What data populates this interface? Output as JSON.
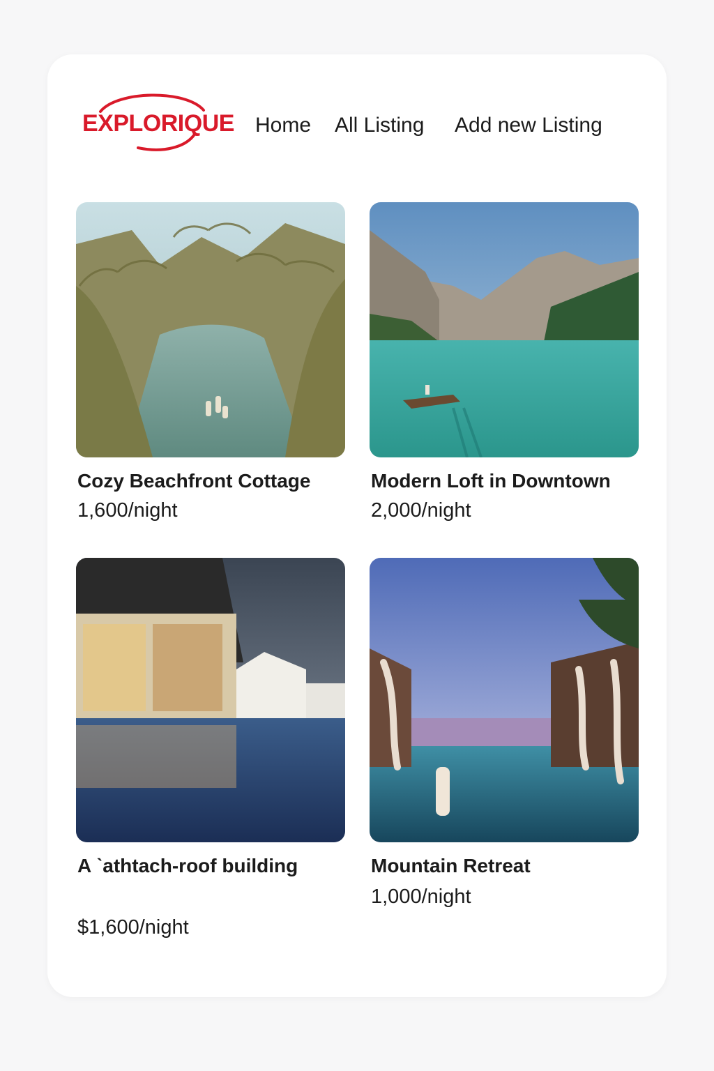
{
  "brand": {
    "name": "EXPLORIQUE",
    "color": "#d91a2a"
  },
  "nav": {
    "home": "Home",
    "all_listing": "All Listing",
    "add_listing": "Add new Listing"
  },
  "listings": [
    {
      "title": "Cozy Beachfront Cottage",
      "price": "1,600/night",
      "image": "tropical-palm-lagoon-photo"
    },
    {
      "title": "Modern Loft in Downtown",
      "price": "2,000/night",
      "image": "mountain-lake-boat-photo"
    },
    {
      "title": "A ˋathtach-roof building",
      "price": "$1,600/night",
      "image": "resort-pool-building-photo"
    },
    {
      "title": "Mountain Retreat",
      "price": "1,000/night",
      "image": "infinity-pool-cabanas-photo"
    }
  ]
}
